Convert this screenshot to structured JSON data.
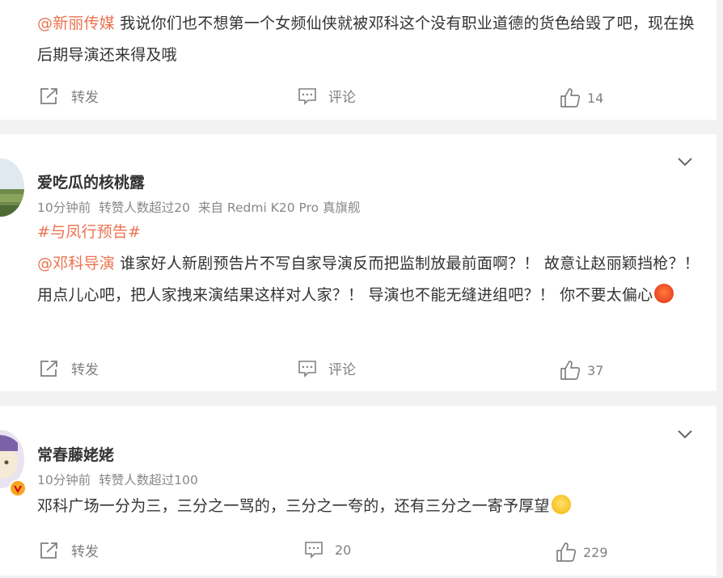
{
  "posts": [
    {
      "mention": "@新丽传媒",
      "text": " 我说你们也不想第一个女频仙侠就被邓科这个没有职业道德的货色给毁了吧，现在换后期导演还来得及哦",
      "actions": {
        "repost": "转发",
        "comment": "评论",
        "likes": "14"
      }
    },
    {
      "username": "爱吃瓜的核桃露",
      "time": "10分钟前",
      "reposts_info": "转赞人数超过20",
      "source": "来自 Redmi K20 Pro 真旗舰",
      "hashtag": "#与凤行预告#",
      "mention": "@邓科导演",
      "text": " 谁家好人新剧预告片不写自家导演反而把监制放最前面啊？！ 故意让赵丽颖挡枪？！ 用点儿心吧，把人家拽来演结果这样对人家？！ 导演也不能无缝进组吧？！ 你不要太偏心",
      "emoji_icon": "angry-face-icon",
      "actions": {
        "repost": "转发",
        "comment": "评论",
        "likes": "37"
      }
    },
    {
      "username": "常春藤姥姥",
      "time": "10分钟前",
      "reposts_info": "转赞人数超过100",
      "text": "邓科广场一分为三，三分之一骂的，三分之一夸的，还有三分之一寄予厚望",
      "emoji_icon": "laughing-tears-icon",
      "actions": {
        "repost": "转发",
        "comments": "20",
        "likes": "229"
      }
    }
  ],
  "colors": {
    "accent": "#eb7350",
    "text": "#333333",
    "meta": "#888888",
    "icon": "#808080"
  }
}
